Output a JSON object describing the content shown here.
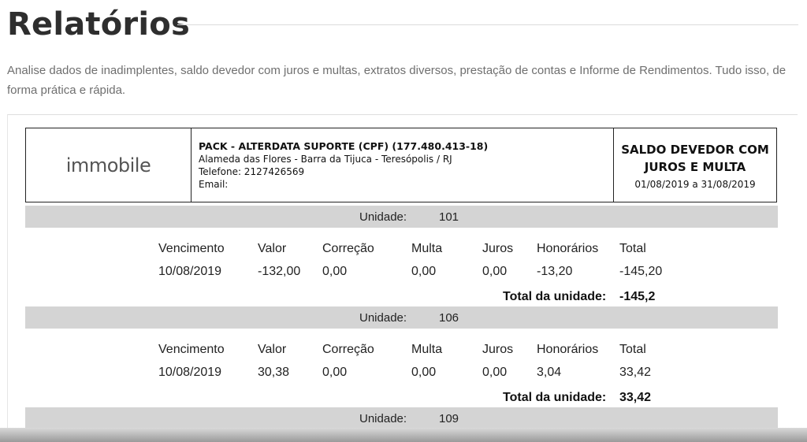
{
  "page": {
    "title": "Relatórios",
    "description": "Analise dados de inadimplentes, saldo devedor com juros e multas, extratos diversos, prestação de contas e Informe de Rendimentos. Tudo isso, de forma prática e rápida."
  },
  "report": {
    "logo": "immobile",
    "company": {
      "name": "PACK - ALTERDATA SUPORTE (CPF) (177.480.413-18)",
      "address": "Alameda das Flores - Barra da Tijuca - Teresópolis / RJ",
      "phone": "Telefone: 2127426569",
      "email": "Email:"
    },
    "title": "SALDO DEVEDOR COM JUROS E MULTA",
    "period": "01/08/2019 a 31/08/2019",
    "unit_label": "Unidade:",
    "total_label": "Total da unidade:",
    "columns": [
      "Vencimento",
      "Valor",
      "Correção",
      "Multa",
      "Juros",
      "Honorários",
      "Total"
    ],
    "units": [
      {
        "number": "101",
        "rows": [
          [
            "10/08/2019",
            "-132,00",
            "0,00",
            "0,00",
            "0,00",
            "-13,20",
            "-145,20"
          ]
        ],
        "total": "-145,2"
      },
      {
        "number": "106",
        "rows": [
          [
            "10/08/2019",
            "30,38",
            "0,00",
            "0,00",
            "0,00",
            "3,04",
            "33,42"
          ]
        ],
        "total": "33,42"
      },
      {
        "number": "109"
      }
    ]
  }
}
